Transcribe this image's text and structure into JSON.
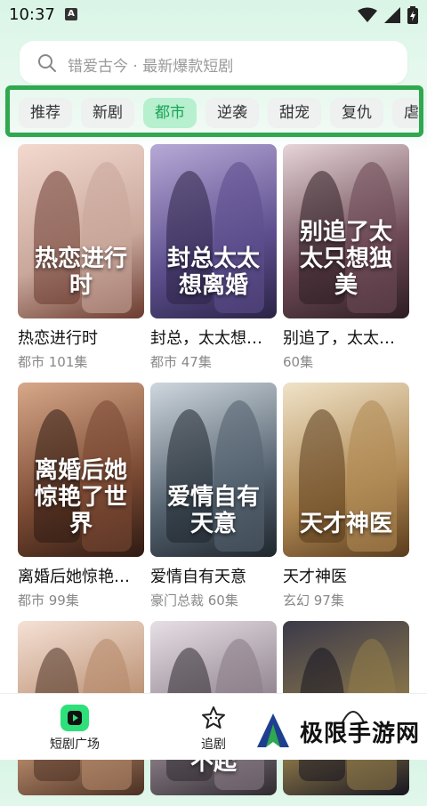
{
  "status_bar": {
    "time": "10:37",
    "notification_letter": "A"
  },
  "search": {
    "placeholder": "错爱古今 · 最新爆款短剧"
  },
  "tabs": [
    {
      "label": "推荐",
      "active": false
    },
    {
      "label": "新剧",
      "active": false
    },
    {
      "label": "都市",
      "active": true
    },
    {
      "label": "逆袭",
      "active": false
    },
    {
      "label": "甜宠",
      "active": false
    },
    {
      "label": "复仇",
      "active": false
    },
    {
      "label": "虐",
      "active": false
    }
  ],
  "accent_color": "#1aa356",
  "dramas": [
    {
      "title": "热恋进行时",
      "meta": "都市 101集",
      "art": "热恋进行时"
    },
    {
      "title": "封总，太太想…",
      "meta": "都市 47集",
      "art": "封总太太想离婚"
    },
    {
      "title": "别追了，太太…",
      "meta": "60集",
      "art": "别追了太太只想独美"
    },
    {
      "title": "离婚后她惊艳…",
      "meta": "都市 99集",
      "art": "离婚后她惊艳了世界"
    },
    {
      "title": "爱情自有天意",
      "meta": "豪门总裁 60集",
      "art": "爱情自有天意"
    },
    {
      "title": "天才神医",
      "meta": "玄幻 97集",
      "art": "天才神医"
    },
    {
      "title": "",
      "meta": "",
      "art": ""
    },
    {
      "title": "",
      "meta": "",
      "art": "我是你惹不起"
    },
    {
      "title": "",
      "meta": "",
      "art": ""
    }
  ],
  "bottom_nav": [
    {
      "label": "短剧广场",
      "icon": "play-icon",
      "active": true
    },
    {
      "label": "追剧",
      "icon": "star-icon",
      "active": false
    }
  ],
  "watermark": {
    "text": "极限手游网"
  }
}
